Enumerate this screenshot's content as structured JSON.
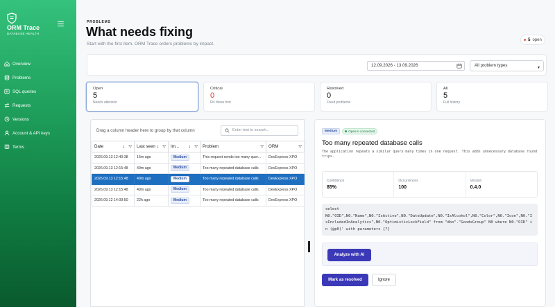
{
  "brand": {
    "name": "ORM Trace",
    "sub": "DATABASE HEALTH"
  },
  "nav": [
    {
      "label": "Overview",
      "icon": "home-icon"
    },
    {
      "label": "Problems",
      "icon": "database-icon"
    },
    {
      "label": "SQL queries",
      "icon": "sql-icon"
    },
    {
      "label": "Requests",
      "icon": "requests-icon"
    },
    {
      "label": "Versions",
      "icon": "versions-icon"
    },
    {
      "label": "Account & API keys",
      "icon": "account-icon"
    },
    {
      "label": "Terms",
      "icon": "terms-icon"
    }
  ],
  "header": {
    "eyebrow": "PROBLEMS",
    "title": "What needs fixing",
    "subtitle": "Start with the first item. ORM Trace orders problems by impact.",
    "open_count": "5",
    "open_label": "open"
  },
  "filters": {
    "date_range": "12.09.2026 - 13.09.2026",
    "problem_type": "All problem types"
  },
  "stats": [
    {
      "label": "Open",
      "value": "5",
      "note": "Needs attention"
    },
    {
      "label": "Critical",
      "value": "0",
      "note": "Fix these first"
    },
    {
      "label": "Resolved",
      "value": "0",
      "note": "Fixed problems"
    },
    {
      "label": "All",
      "value": "5",
      "note": "Full history"
    }
  ],
  "grid": {
    "group_hint": "Drag a column header here to group by that column",
    "search_placeholder": "Enter text to search...",
    "columns": [
      "Date",
      "Last seen",
      "Im...",
      "Problem",
      "ORM"
    ],
    "rows": [
      {
        "date": "2026.09.13 12:40:38",
        "last_seen": "15m ago",
        "impact": "Medium",
        "problem": "This request sends too many quer...",
        "orm": "DevExpress XPO"
      },
      {
        "date": "2026.09.13 12:15:48",
        "last_seen": "40m ago",
        "impact": "Medium",
        "problem": "Too many repeated database calls",
        "orm": "DevExpress XPO"
      },
      {
        "date": "2026.09.13 12:15:48",
        "last_seen": "40m ago",
        "impact": "Medium",
        "problem": "Too many repeated database calls",
        "orm": "DevExpress XPO"
      },
      {
        "date": "2026.09.13 12:15:48",
        "last_seen": "40m ago",
        "impact": "Medium",
        "problem": "Too many repeated database calls",
        "orm": "DevExpress XPO"
      },
      {
        "date": "2026.09.12 14:09:50",
        "last_seen": "22h ago",
        "impact": "Medium",
        "problem": "Too many repeated database calls",
        "orm": "DevExpress XPO"
      }
    ]
  },
  "detail": {
    "severity": "Medium",
    "ai_status": "OpenAI connected",
    "title": "Too many repeated database calls",
    "description": "The application repeats a similar query many times in one request. This adds unnecessary database round trips.",
    "metrics": [
      {
        "label": "Confidence",
        "value": "85%"
      },
      {
        "label": "Occurrences",
        "value": "100"
      },
      {
        "label": "Version",
        "value": "0.4.0"
      }
    ],
    "sql": "select\nN0.\"OID\",N0.\"Name\",N0.\"IsActive\",N0.\"DateUpdate\",N0.\"IsAlcohol\",N0.\"Color\",N0.\"Icon\",N0.\"IsIncludedInAnalytics\",N0.\"OptimisticLockField\" from \"dbo\".\"GoodsGroup\" N0 where N0.\"OID\" in (@p0)' with parameters {?}",
    "analyze_label": "Analyze with AI",
    "resolve_label": "Mark as resolved",
    "ignore_label": "Ignore"
  }
}
